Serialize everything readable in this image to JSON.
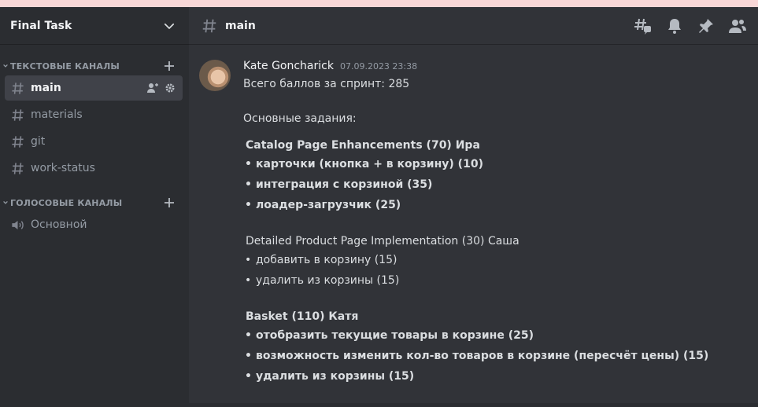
{
  "server": {
    "name": "Final Task"
  },
  "categories": {
    "text": {
      "label": "ТЕКСТОВЫЕ КАНАЛЫ"
    },
    "voice": {
      "label": "ГОЛОСОВЫЕ КАНАЛЫ"
    }
  },
  "text_channels": [
    {
      "label": "main"
    },
    {
      "label": "materials"
    },
    {
      "label": "git"
    },
    {
      "label": "work-status"
    }
  ],
  "voice_channels": [
    {
      "label": "Основной"
    }
  ],
  "header": {
    "channel": "main"
  },
  "message": {
    "author": "Kate Goncharick",
    "timestamp": "07.09.2023 23:38",
    "total": "Всего баллов за спринт: 285",
    "intro": "Основные задания:",
    "sections": [
      {
        "title": "Catalog Page Enhancements (70) Ира",
        "bold": true,
        "items": [
          "карточки (кнопка + в корзину) (10)",
          "интеграция с корзиной (35)",
          "лоадер-загрузчик (25)"
        ]
      },
      {
        "title": "Detailed Product Page Implementation (30)  Саша",
        "bold": false,
        "items": [
          "добавить в корзину (15)",
          "удалить из корзины (15)"
        ]
      },
      {
        "title": "Basket (110) Катя",
        "bold": true,
        "items": [
          "отобразить текущие товары в корзине (25)",
          "возможность изменить кол-во товаров в корзине (пересчёт цены) (15)",
          "удалить из корзины (15)"
        ]
      }
    ]
  },
  "icons": {
    "header": [
      "threads-icon",
      "bell-icon",
      "pin-icon",
      "members-icon"
    ]
  }
}
